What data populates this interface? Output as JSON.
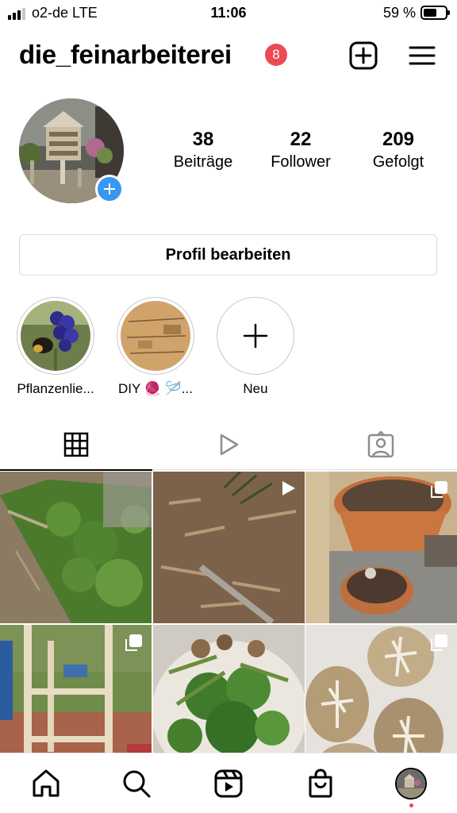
{
  "status_bar": {
    "carrier": "o2-de  LTE",
    "time": "11:06",
    "battery": "59 %",
    "battery_level": 0.59
  },
  "header": {
    "username": "die_feinarbeiterei",
    "notifications": "8"
  },
  "profile": {
    "stats": [
      {
        "value": "38",
        "label": "Beiträge"
      },
      {
        "value": "22",
        "label": "Follower"
      },
      {
        "value": "209",
        "label": "Gefolgt"
      }
    ],
    "edit_label": "Profil bearbeiten"
  },
  "highlights": [
    {
      "label": "Pflanzenlie..."
    },
    {
      "label": "DIY 🧶 🪡..."
    },
    {
      "label": "Neu"
    }
  ],
  "tabs": [
    "grid-icon",
    "reels-icon",
    "tagged-icon"
  ],
  "posts": [
    {
      "subject": "garden-bed",
      "badge": ""
    },
    {
      "subject": "bark-mulch",
      "badge": "reel"
    },
    {
      "subject": "terracotta-pots",
      "badge": "multiple"
    },
    {
      "subject": "wooden-frame",
      "badge": "multiple"
    },
    {
      "subject": "salad-plate",
      "badge": ""
    },
    {
      "subject": "dyed-eggs",
      "badge": "multiple"
    }
  ],
  "bottom_nav": [
    "home-icon",
    "search-icon",
    "reels-icon",
    "shop-icon",
    "profile-avatar"
  ],
  "colors": {
    "badge": "#ed4956",
    "accent": "#3897f0"
  }
}
